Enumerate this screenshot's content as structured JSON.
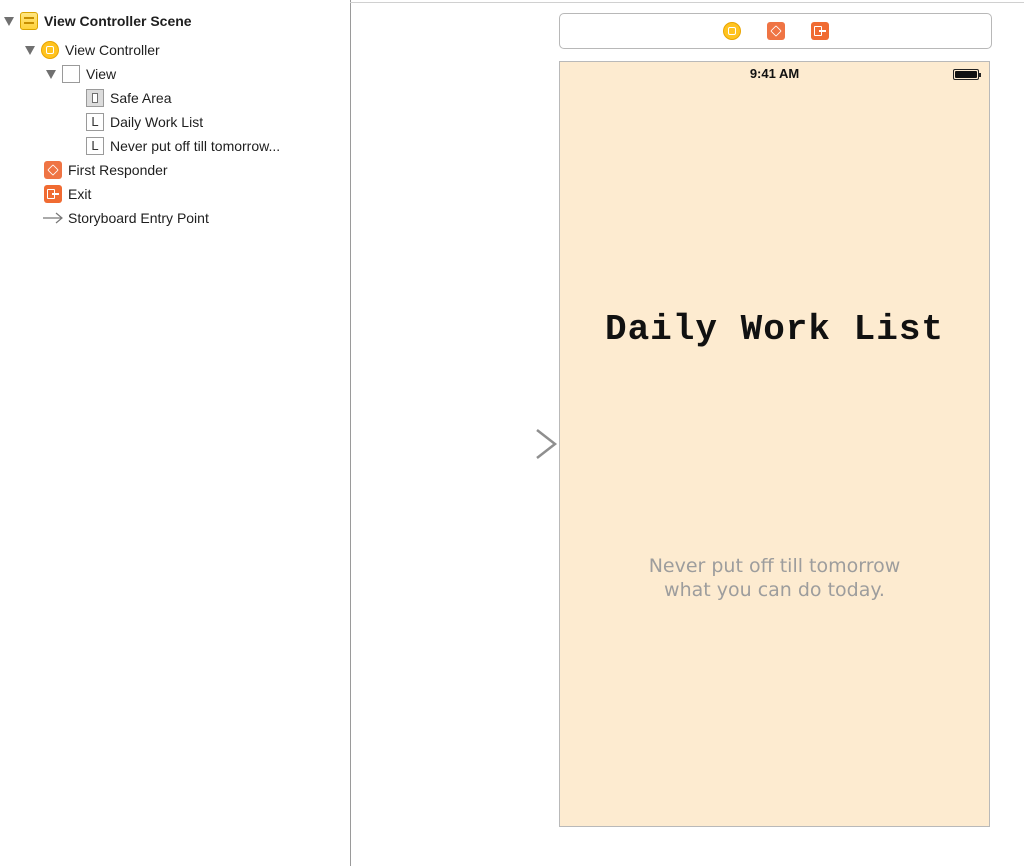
{
  "outline": {
    "scene_title": "View Controller Scene",
    "view_controller": "View Controller",
    "view": "View",
    "safe_area": "Safe Area",
    "label_title": "Daily Work List",
    "label_tagline": "Never put off till tomorrow...",
    "first_responder": "First Responder",
    "exit": "Exit",
    "entry_point": "Storyboard Entry Point"
  },
  "canvas": {
    "status_time": "9:41 AM",
    "title": "Daily Work List",
    "tagline_line1": "Never put off till tomorrow",
    "tagline_line2": "what you can do today."
  },
  "colors": {
    "view_background": "#fdebd0",
    "tagline_text": "#9d9d9d",
    "scene_icon": "#ffd23a",
    "responder_icon": "#ef7444"
  },
  "icons": [
    "scene-icon",
    "view-controller-icon",
    "view-icon",
    "safe-area-icon",
    "label-icon",
    "first-responder-icon",
    "exit-icon",
    "entry-point-arrow-icon"
  ]
}
